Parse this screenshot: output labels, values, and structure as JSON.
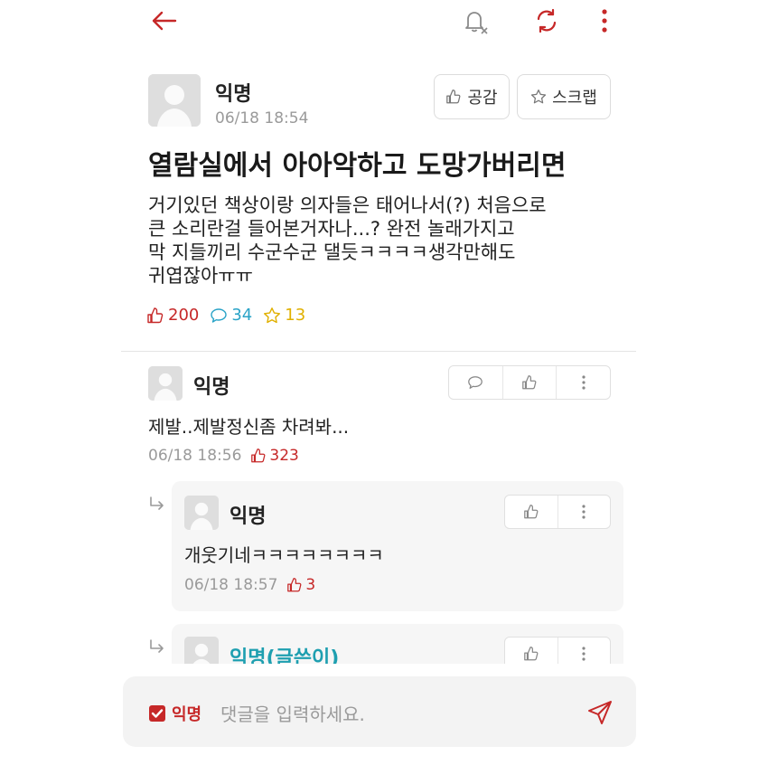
{
  "post": {
    "author": "익명",
    "time": "06/18 18:54",
    "title": "열람실에서 아아악하고 도망가버리면",
    "body_lines": [
      "거기있던 책상이랑 의자들은 태어나서(?) 처음으로",
      "큰 소리란걸 들어본거자나...? 완전 놀래가지고",
      "막 지들끼리 수군수군 댈듯ㅋㅋㅋㅋ생각만해도",
      "귀엽잖아ㅠㅠ"
    ],
    "like_label": "공감",
    "scrap_label": "스크랩",
    "likes": "200",
    "comments": "34",
    "scraps": "13"
  },
  "comments": [
    {
      "author": "익명",
      "text": "제발..제발정신좀 차려봐...",
      "time": "06/18 18:56",
      "likes": "323",
      "replies": [
        {
          "author": "익명",
          "text": "개웃기네ㅋㅋㅋㅋㅋㅋㅋㅋ",
          "time": "06/18 18:57",
          "likes": "3"
        },
        {
          "author": "익명(글쓴이)"
        }
      ]
    }
  ],
  "composer": {
    "anon_label": "익명",
    "placeholder": "댓글을 입력하세요."
  },
  "colors": {
    "accent": "#c62828",
    "writer": "#1e9fb0",
    "comment_icon": "#29a3c7",
    "scrap_icon": "#e0b000"
  }
}
